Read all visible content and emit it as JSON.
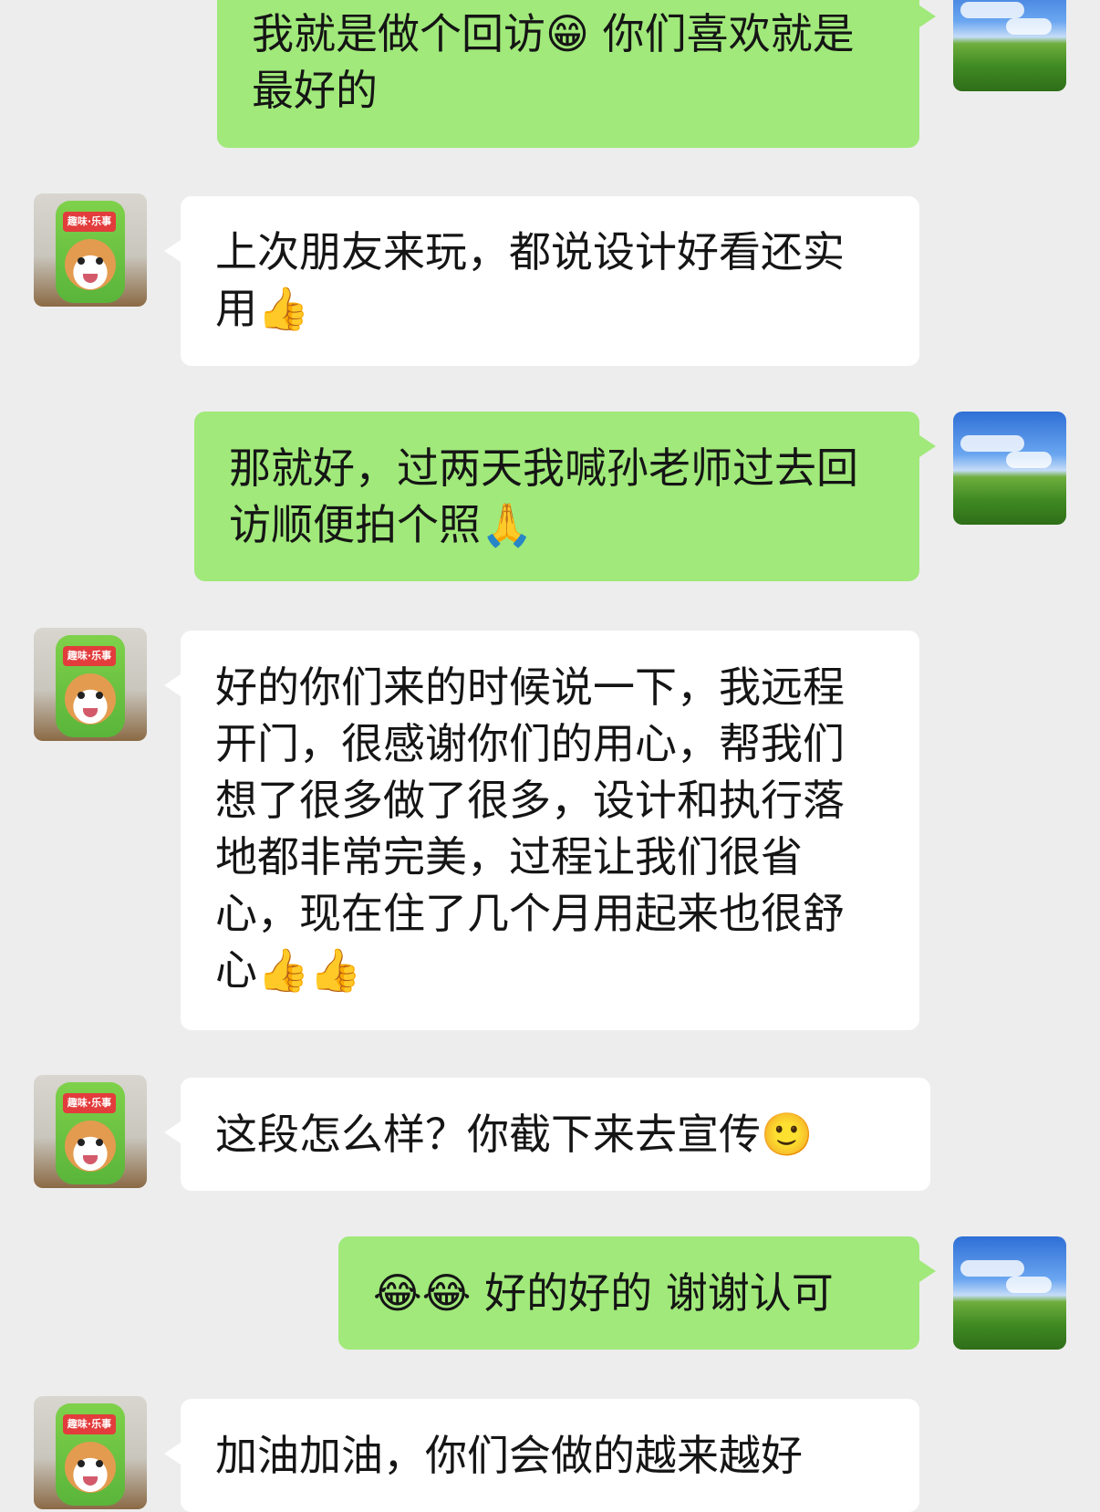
{
  "messages": [
    {
      "side": "out",
      "text": "我就是做个回访😁 你们喜欢就是最好的"
    },
    {
      "side": "in",
      "text": "上次朋友来玩，都说设计好看还实用👍"
    },
    {
      "side": "out",
      "text": "那就好，过两天我喊孙老师过去回访顺便拍个照🙏"
    },
    {
      "side": "in",
      "text": "好的你们来的时候说一下，我远程开门，很感谢你们的用心，帮我们想了很多做了很多，设计和执行落地都非常完美，过程让我们很省心，现在住了几个月用起来也很舒心👍👍"
    },
    {
      "side": "in",
      "text": "这段怎么样？你截下来去宣传🙂"
    },
    {
      "side": "out",
      "text": "😂😂 好的好的 谢谢认可"
    },
    {
      "side": "in",
      "text": "加油加油，你们会做的越来越好"
    }
  ],
  "avatars": {
    "self": "xp-bliss-avatar",
    "contact": "corgi-avatar",
    "contact_bag_text": "趣味·乐事"
  }
}
